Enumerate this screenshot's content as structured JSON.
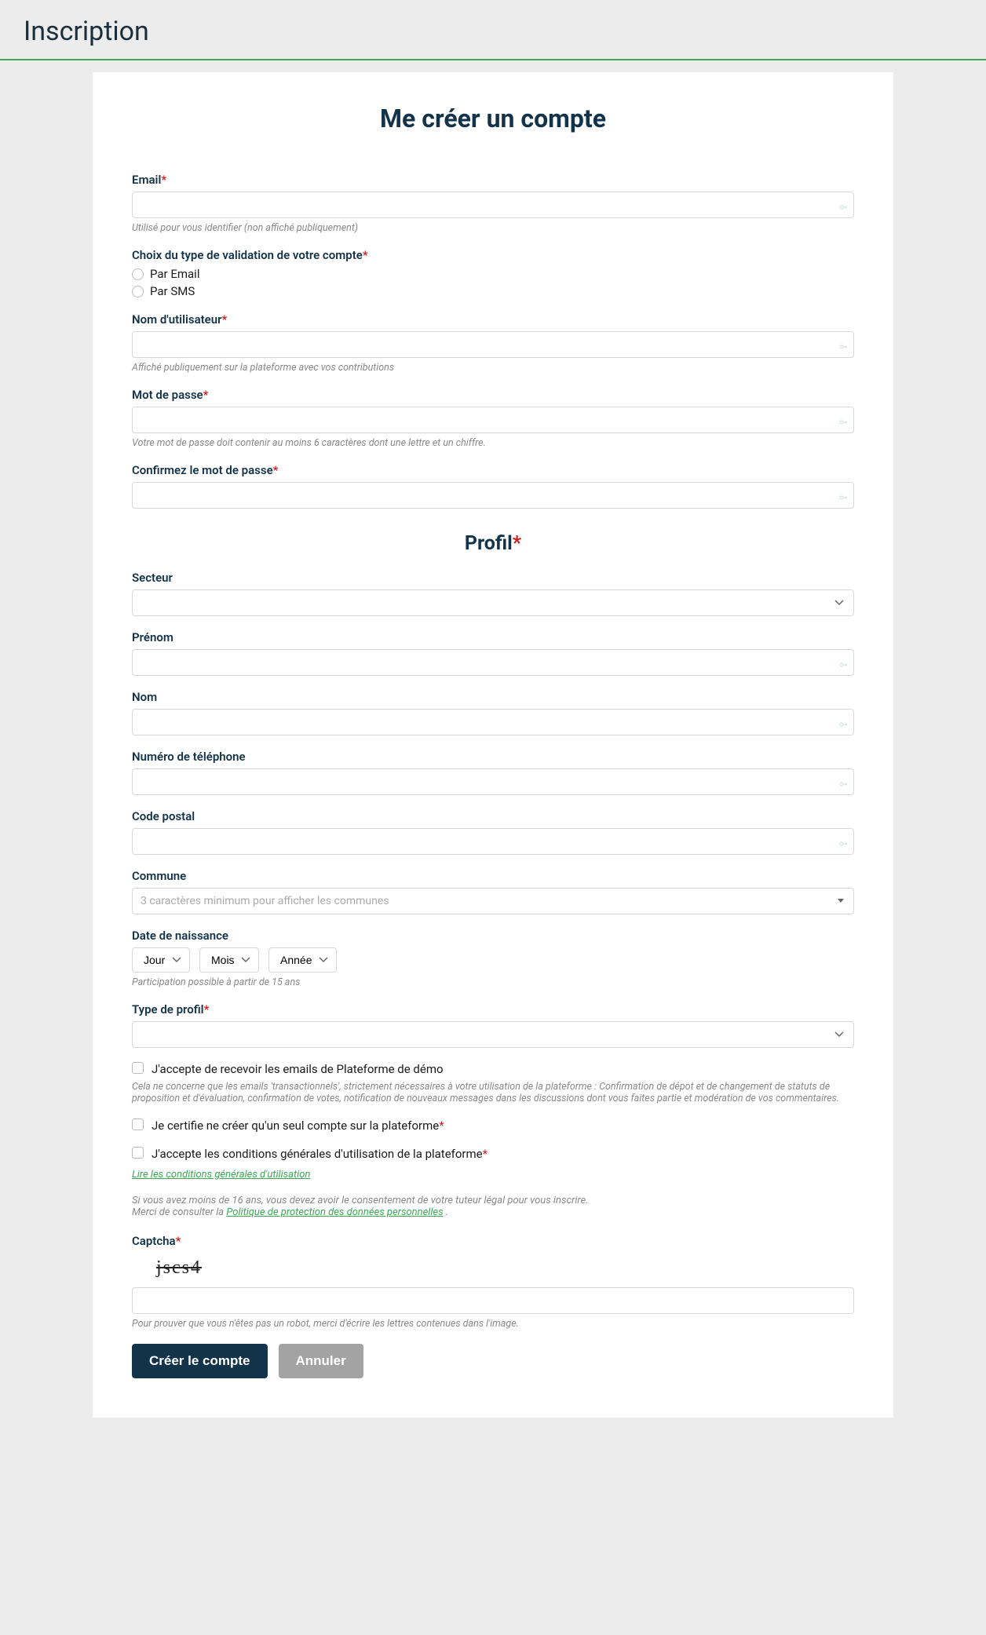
{
  "page": {
    "title": "Inscription"
  },
  "card": {
    "title": "Me créer un compte"
  },
  "fields": {
    "email": {
      "label": "Email",
      "help": "Utilisé pour vous identifier (non affiché publiquement)"
    },
    "validation": {
      "label": "Choix du type de validation de votre compte",
      "opt_email": "Par Email",
      "opt_sms": "Par SMS"
    },
    "username": {
      "label": "Nom d'utilisateur",
      "help": "Affiché publiquement sur la plateforme avec vos contributions"
    },
    "password": {
      "label": "Mot de passe",
      "help": "Votre mot de passe doit contenir au moins 6 caractères dont une lettre et un chiffre."
    },
    "password_confirm": {
      "label": "Confirmez le mot de passe"
    },
    "profile_heading": "Profil",
    "sector": {
      "label": "Secteur"
    },
    "firstname": {
      "label": "Prénom"
    },
    "lastname": {
      "label": "Nom"
    },
    "phone": {
      "label": "Numéro de téléphone"
    },
    "zip": {
      "label": "Code postal"
    },
    "commune": {
      "label": "Commune",
      "placeholder": "3 caractères minimum pour afficher les communes"
    },
    "dob": {
      "label": "Date de naissance",
      "day": "Jour",
      "month": "Mois",
      "year": "Année",
      "help": "Participation possible à partir de 15 ans"
    },
    "profile_type": {
      "label": "Type de profil"
    },
    "emails_consent": {
      "label": "J'accepte de recevoir les emails de Plateforme de démo",
      "help": "Cela ne concerne que les emails 'transactionnels', strictement nécessaires à votre utilisation de la plateforme : Confirmation de dépot et de changement de statuts de proposition et d'évaluation, confirmation de votes, notification de nouveaux messages dans les discussions dont vous faites partie et modération de vos commentaires."
    },
    "single_account": {
      "label": "Je certifie ne créer qu'un seul compte sur la plateforme"
    },
    "cgu": {
      "label": "J'accepte les conditions générales d'utilisation de la plateforme",
      "link": "Lire les conditions générales d'utilisation"
    },
    "minor_note": {
      "line1": "Si vous avez moins de 16 ans, vous devez avoir le consentement de votre tuteur légal pour vous inscrire.",
      "line2a": "Merci de consulter la ",
      "policy_link": "Politique de protection des données personnelles",
      "line2b": " ."
    },
    "captcha": {
      "label": "Captcha",
      "value": "jscs4",
      "help": "Pour prouver que vous n'êtes pas un robot, merci d'écrire les lettres contenues dans l'image."
    }
  },
  "buttons": {
    "create": "Créer le compte",
    "cancel": "Annuler"
  }
}
